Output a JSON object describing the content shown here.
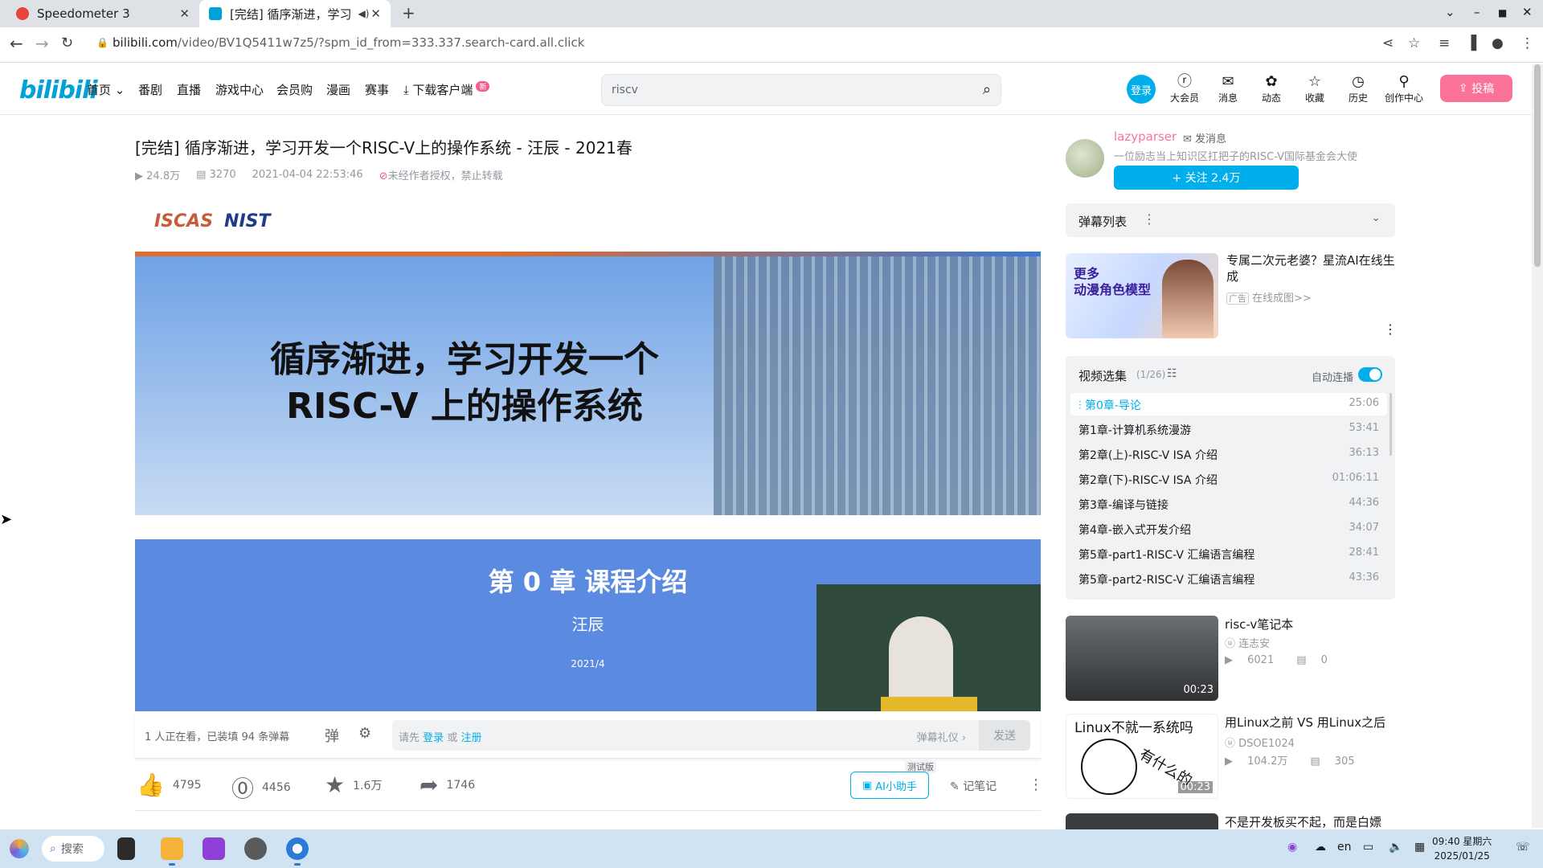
{
  "browser": {
    "tabs": [
      {
        "title": "Speedometer 3"
      },
      {
        "title": "[完结] 循序渐进，学习"
      }
    ],
    "url_host": "bilibili.com",
    "url_path": "/video/BV1Q5411w7z5/?spm_id_from=333.337.search-card.all.click"
  },
  "header": {
    "logo": "bilibili",
    "nav": [
      "首页",
      "番剧",
      "直播",
      "游戏中心",
      "会员购",
      "漫画",
      "赛事",
      "下载客户端"
    ],
    "download_badge": "新",
    "search_value": "riscv",
    "login": "登录",
    "icons": [
      {
        "label": "大会员",
        "icon": "vip-icon"
      },
      {
        "label": "消息",
        "icon": "message-icon"
      },
      {
        "label": "动态",
        "icon": "dynamic-icon"
      },
      {
        "label": "收藏",
        "icon": "star-icon"
      },
      {
        "label": "历史",
        "icon": "history-icon"
      },
      {
        "label": "创作中心",
        "icon": "creator-icon"
      }
    ],
    "upload": "投稿"
  },
  "video": {
    "title": "[完结] 循序渐进，学习开发一个RISC-V上的操作系统 - 汪辰 - 2021春",
    "views": "24.8万",
    "danmaku_count": "3270",
    "date": "2021-04-04 22:53:46",
    "copyright": "未经作者授权，禁止转载"
  },
  "slide": {
    "logo_left": "ISCAS",
    "logo_right": "NIST",
    "heading_line1": "循序渐进，学习开发一个",
    "heading_line2": "RISC-V 上的操作系统",
    "chapter": "第 0 章 课程介绍",
    "author": "汪辰",
    "date": "2021/4"
  },
  "danmaku_bar": {
    "viewers": "1 人正在看，已装填 94 条弹幕",
    "placeholder_prefix": "请先",
    "login": "登录",
    "or": "或",
    "register": "注册",
    "etiquette": "弹幕礼仪 ›",
    "send": "发送"
  },
  "actions": {
    "like": "4795",
    "coin": "4456",
    "favorite": "1.6万",
    "share": "1746",
    "ai_tag": "测试版",
    "ai": "AI小助手",
    "notes": "记笔记"
  },
  "uploader": {
    "name": "lazyparser",
    "message": "发消息",
    "desc": "一位励志当上知识区扛把子的RISC-V国际基金会大使",
    "follow": "+ 关注 2.4万"
  },
  "danmaku_list": {
    "title": "弹幕列表"
  },
  "ad": {
    "image_text_1": "更多",
    "image_text_2": "动漫角色模型",
    "title": "专属二次元老婆？星流AI在线生成",
    "badge": "广告",
    "sub": "在线成图>>"
  },
  "collection": {
    "title": "视频选集",
    "count": "(1/26)",
    "autoplay": "自动连播",
    "episodes": [
      {
        "name": "第0章-导论",
        "duration": "25:06"
      },
      {
        "name": "第1章-计算机系统漫游",
        "duration": "53:41"
      },
      {
        "name": "第2章(上)-RISC-V ISA 介绍",
        "duration": "36:13"
      },
      {
        "name": "第2章(下)-RISC-V ISA 介绍",
        "duration": "01:06:11"
      },
      {
        "name": "第3章-编译与链接",
        "duration": "44:36"
      },
      {
        "name": "第4章-嵌入式开发介绍",
        "duration": "34:07"
      },
      {
        "name": "第5章-part1-RISC-V 汇编语言编程",
        "duration": "28:41"
      },
      {
        "name": "第5章-part2-RISC-V 汇编语言编程",
        "duration": "43:36"
      }
    ]
  },
  "recommendations": [
    {
      "title": "risc-v笔记本",
      "up": "连志安",
      "views": "6021",
      "danmaku": "0",
      "duration": "00:23"
    },
    {
      "title": "用Linux之前 VS 用Linux之后",
      "up": "DSOE1024",
      "views": "104.2万",
      "danmaku": "305",
      "duration": "00:23",
      "thumb_text_1": "Linux不就一系统吗",
      "thumb_text_2": "有什么的"
    },
    {
      "title": "不是开发板买不起，而是白嫖"
    }
  ],
  "taskbar": {
    "search": "搜索",
    "lang": "en",
    "time": "09:40 星期六",
    "date": "2025/01/25"
  }
}
